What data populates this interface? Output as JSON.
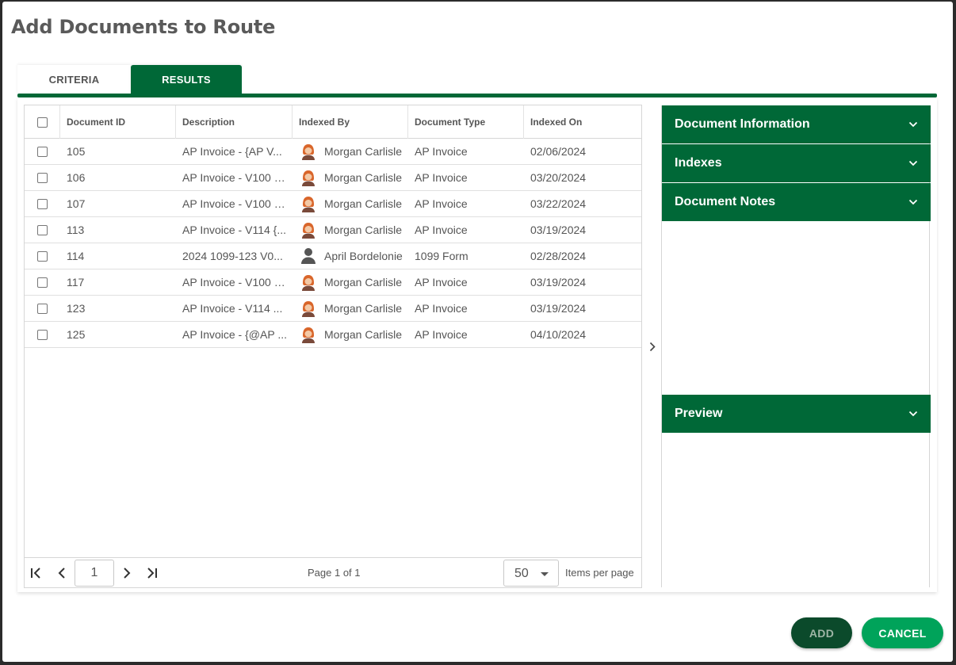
{
  "dialog": {
    "title": "Add Documents to Route"
  },
  "tabs": [
    {
      "label": "CRITERIA"
    },
    {
      "label": "RESULTS"
    }
  ],
  "grid": {
    "columns": [
      "Document ID",
      "Description",
      "Indexed By",
      "Document Type",
      "Indexed On"
    ],
    "rows": [
      {
        "id": "105",
        "description": "AP Invoice - {AP V...",
        "indexed_by": "Morgan Carlisle",
        "avatar": "female-avatar-icon",
        "type": "AP Invoice",
        "indexed_on": "02/06/2024"
      },
      {
        "id": "106",
        "description": "AP Invoice - V100 {...",
        "indexed_by": "Morgan Carlisle",
        "avatar": "female-avatar-icon",
        "type": "AP Invoice",
        "indexed_on": "03/20/2024"
      },
      {
        "id": "107",
        "description": "AP Invoice - V100 {...",
        "indexed_by": "Morgan Carlisle",
        "avatar": "female-avatar-icon",
        "type": "AP Invoice",
        "indexed_on": "03/22/2024"
      },
      {
        "id": "113",
        "description": "AP Invoice - V114 {...",
        "indexed_by": "Morgan Carlisle",
        "avatar": "female-avatar-icon",
        "type": "AP Invoice",
        "indexed_on": "03/19/2024"
      },
      {
        "id": "114",
        "description": "2024 1099-123 V0...",
        "indexed_by": "April Bordelonie",
        "avatar": "generic-user-icon",
        "type": "1099 Form",
        "indexed_on": "02/28/2024"
      },
      {
        "id": "117",
        "description": "AP Invoice - V100 {...",
        "indexed_by": "Morgan Carlisle",
        "avatar": "female-avatar-icon",
        "type": "AP Invoice",
        "indexed_on": "03/19/2024"
      },
      {
        "id": "123",
        "description": "AP Invoice - V114 ...",
        "indexed_by": "Morgan Carlisle",
        "avatar": "female-avatar-icon",
        "type": "AP Invoice",
        "indexed_on": "03/19/2024"
      },
      {
        "id": "125",
        "description": "AP Invoice - {@AP ...",
        "indexed_by": "Morgan Carlisle",
        "avatar": "female-avatar-icon",
        "type": "AP Invoice",
        "indexed_on": "04/10/2024"
      }
    ]
  },
  "pager": {
    "current_page": "1",
    "page_info": "Page 1 of 1",
    "items_per_page": "50",
    "items_per_page_label": "Items per page"
  },
  "side_panel": {
    "sections": [
      "Document Information",
      "Indexes",
      "Document Notes"
    ],
    "preview_label": "Preview"
  },
  "actions": {
    "add_label": "ADD",
    "cancel_label": "CANCEL"
  },
  "colors": {
    "primary_green": "#006837",
    "cancel_green": "#00a35a",
    "add_dark_green": "#0b4a2b"
  }
}
